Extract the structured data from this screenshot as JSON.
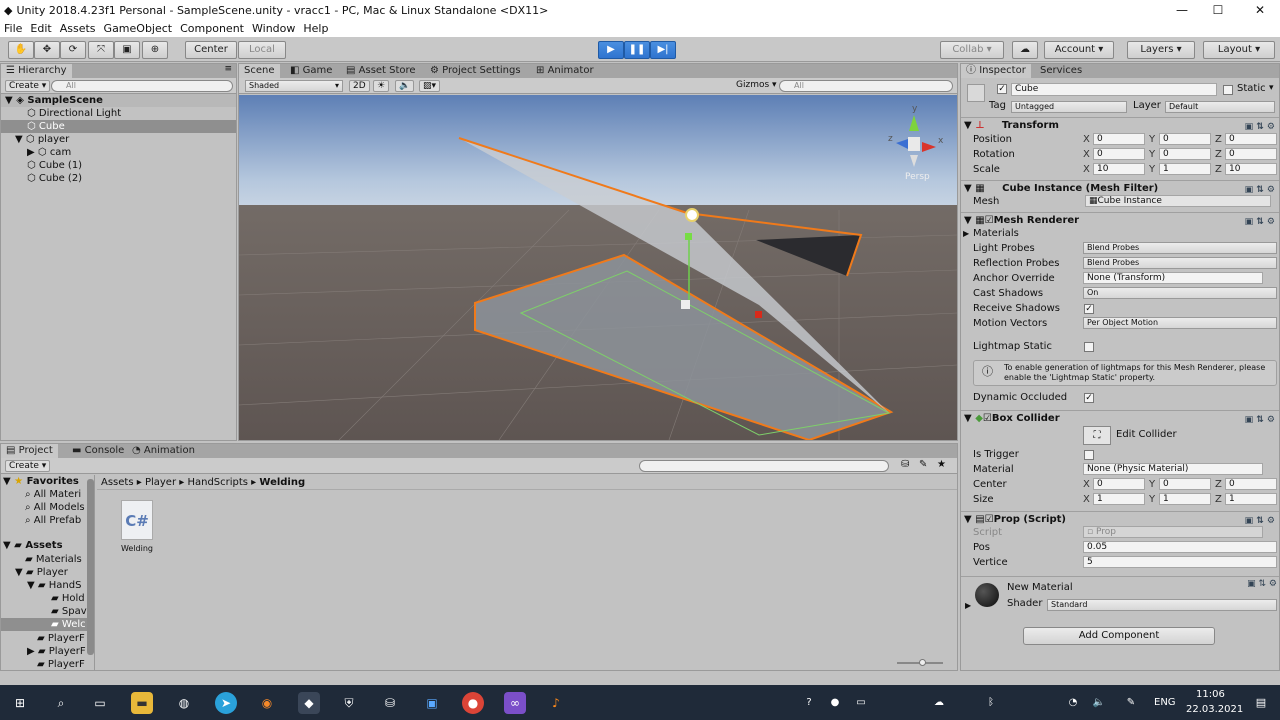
{
  "window": {
    "title": "Unity 2018.4.23f1 Personal - SampleScene.unity - vracc1 - PC, Mac & Linux Standalone <DX11>",
    "min": "—",
    "max": "☐",
    "close": "✕"
  },
  "menu": [
    "File",
    "Edit",
    "Assets",
    "GameObject",
    "Component",
    "Window",
    "Help"
  ],
  "toolbar": {
    "center": "Center",
    "local": "Local",
    "collab": "Collab ▾",
    "account": "Account ▾",
    "layers": "Layers",
    "layout": "Layout"
  },
  "hierarchy": {
    "tab": "Hierarchy",
    "create": "Create ▾",
    "search": "All",
    "scene": "SampleScene",
    "items": [
      "Directional Light",
      "Cube",
      "player",
      "cam",
      "Cube (1)",
      "Cube (2)"
    ]
  },
  "scene": {
    "tabs": [
      "Scene",
      "Game",
      "Asset Store",
      "Project Settings",
      "Animator"
    ],
    "shading": "Shaded",
    "mode2d": "2D",
    "gizmos": "Gizmos ▾",
    "search": "All",
    "persp": "Persp",
    "gizmo_axes": [
      "y",
      "x",
      "z"
    ]
  },
  "project": {
    "tabs": [
      "Project",
      "Console",
      "Animation"
    ],
    "create": "Create ▾",
    "favorites": "Favorites",
    "fav_items": [
      "All Materi",
      "All Models",
      "All Prefab"
    ],
    "assets": "Assets",
    "asset_items": [
      "Materials",
      "Player",
      "HandS",
      "Hold",
      "Spav",
      "Welc",
      "PlayerF",
      "PlayerF",
      "PlayerF"
    ],
    "breadcrumb": [
      "Assets",
      "Player",
      "HandScripts",
      "Welding"
    ],
    "file": {
      "name": "Welding",
      "icon": "C#"
    }
  },
  "inspector": {
    "tabs": [
      "Inspector",
      "Services"
    ],
    "name": "Cube",
    "static": "Static",
    "tag_label": "Tag",
    "tag": "Untagged",
    "layer_label": "Layer",
    "layer": "Default",
    "transform": {
      "title": "Transform",
      "rows": [
        {
          "label": "Position",
          "x": "0",
          "y": "0",
          "z": "0"
        },
        {
          "label": "Rotation",
          "x": "0",
          "y": "0",
          "z": "0"
        },
        {
          "label": "Scale",
          "x": "10",
          "y": "1",
          "z": "10"
        }
      ]
    },
    "meshfilter": {
      "title": "Cube Instance (Mesh Filter)",
      "mesh_label": "Mesh",
      "mesh": "Cube Instance"
    },
    "renderer": {
      "title": "Mesh Renderer",
      "materials": "Materials",
      "light_probes_label": "Light Probes",
      "light_probes": "Blend Probes",
      "refl_label": "Reflection Probes",
      "refl": "Blend Probes",
      "anchor_label": "Anchor Override",
      "anchor": "None (Transform)",
      "cast_label": "Cast Shadows",
      "cast": "On",
      "receive_label": "Receive Shadows",
      "motion_label": "Motion Vectors",
      "motion": "Per Object Motion",
      "lightmap_label": "Lightmap Static",
      "info": "To enable generation of lightmaps for this Mesh Renderer, please enable the 'Lightmap Static' property.",
      "occluded_label": "Dynamic Occluded"
    },
    "collider": {
      "title": "Box Collider",
      "edit": "Edit Collider",
      "trigger_label": "Is Trigger",
      "material_label": "Material",
      "material": "None (Physic Material)",
      "center": {
        "label": "Center",
        "x": "0",
        "y": "0",
        "z": "0"
      },
      "size": {
        "label": "Size",
        "x": "1",
        "y": "1",
        "z": "1"
      }
    },
    "script": {
      "title": "Prop (Script)",
      "script_label": "Script",
      "script": "Prop",
      "pos_label": "Pos",
      "pos": "0.05",
      "vertice_label": "Vertice",
      "vertice": "5"
    },
    "material": {
      "name": "New Material",
      "shader_label": "Shader",
      "shader": "Standard"
    },
    "add": "Add Component"
  },
  "tray": {
    "lang": "ENG",
    "time": "11:06",
    "date": "22.03.2021"
  }
}
